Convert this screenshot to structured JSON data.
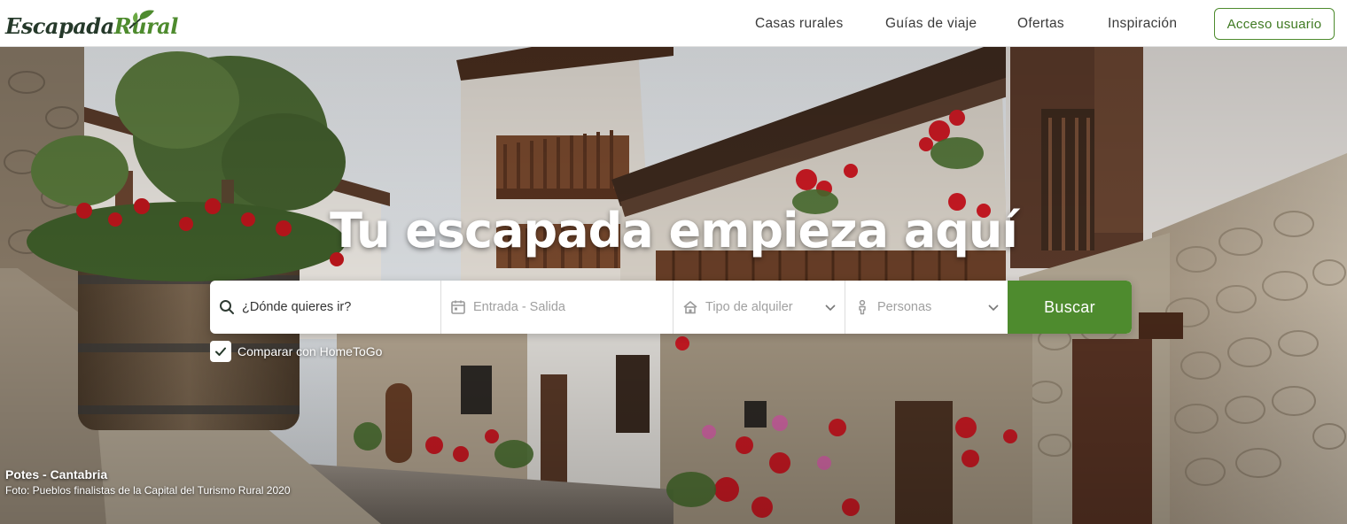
{
  "brand": {
    "name_part1": "Escapada",
    "name_part2": "Rural",
    "colors": {
      "green": "#4e8b2e",
      "dark": "#25392a"
    }
  },
  "nav": {
    "items": [
      {
        "label": "Casas rurales"
      },
      {
        "label": "Guías de viaje"
      },
      {
        "label": "Ofertas"
      },
      {
        "label": "Inspiración"
      }
    ],
    "login_label": "Acceso usuario"
  },
  "hero": {
    "title": "Tu escapada empieza aquí",
    "photo_location": "Potes - Cantabria",
    "photo_credit": "Foto: Pueblos finalistas de la Capital del Turismo Rural 2020"
  },
  "search": {
    "destination_placeholder": "¿Dónde quieres ir?",
    "dates_placeholder": "Entrada - Salida",
    "type_placeholder": "Tipo de alquiler",
    "people_placeholder": "Personas",
    "button_label": "Buscar",
    "compare_label": "Comparar con HomeToGo",
    "compare_checked": true
  },
  "icons": {
    "destination": "search-icon",
    "dates": "calendar-icon",
    "type": "house-icon",
    "people": "person-icon",
    "dropdown": "chevron-down-icon",
    "checkbox": "check-icon",
    "logo_leaf": "leaf-icon"
  }
}
